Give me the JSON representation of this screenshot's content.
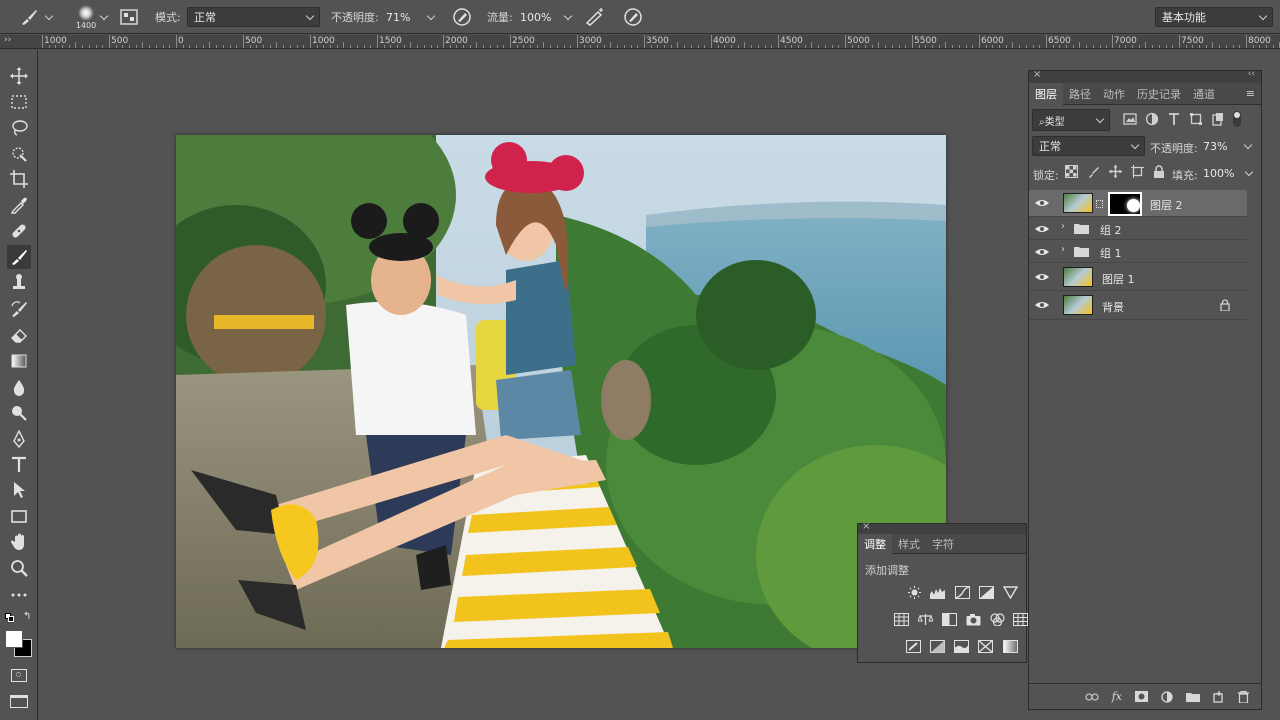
{
  "options_bar": {
    "brush_size": "1400",
    "mode_label": "模式:",
    "mode_value": "正常",
    "opacity_label": "不透明度:",
    "opacity_value": "71%",
    "flow_label": "流量:",
    "flow_value": "100%",
    "workspace": "基本功能"
  },
  "ruler": {
    "labels": [
      "1000",
      "500",
      "0",
      "500",
      "1000",
      "1500",
      "2000",
      "2500",
      "3000",
      "3500",
      "4000",
      "4500",
      "5000",
      "5500",
      "6000",
      "6500",
      "7000",
      "7500",
      "8000"
    ]
  },
  "toolbar": {
    "tools": [
      "move-tool",
      "marquee-tool",
      "lasso-tool",
      "quick-select-tool",
      "crop-tool",
      "eyedropper-tool",
      "healing-brush-tool",
      "brush-tool",
      "clone-stamp-tool",
      "history-brush-tool",
      "eraser-tool",
      "gradient-tool",
      "blur-tool",
      "dodge-tool",
      "pen-tool",
      "type-tool",
      "path-select-tool",
      "rectangle-tool",
      "hand-tool",
      "zoom-tool",
      "more-tools"
    ],
    "active": "brush-tool",
    "foreground": "#ffffff",
    "background": "#000000"
  },
  "layers_panel": {
    "tabs": [
      "图层",
      "路径",
      "动作",
      "历史记录",
      "通道"
    ],
    "active_tab": "图层",
    "filter_label": "类型",
    "blend_mode": "正常",
    "opacity_label": "不透明度:",
    "opacity_value": "73%",
    "lock_label": "锁定:",
    "fill_label": "填充:",
    "fill_value": "100%",
    "layers": [
      {
        "name": "图层 2",
        "type": "masked",
        "selected": true
      },
      {
        "name": "组 2",
        "type": "group"
      },
      {
        "name": "组 1",
        "type": "group"
      },
      {
        "name": "图层 1",
        "type": "pixel"
      },
      {
        "name": "背景",
        "type": "background",
        "locked": true
      }
    ]
  },
  "adjustments_panel": {
    "tabs": [
      "调整",
      "样式",
      "字符"
    ],
    "active_tab": "调整",
    "heading": "添加调整"
  },
  "colors": {
    "ui_bg": "#535353",
    "panel_dark": "#3c3c3c",
    "selected_row": "#6a6a6a"
  }
}
